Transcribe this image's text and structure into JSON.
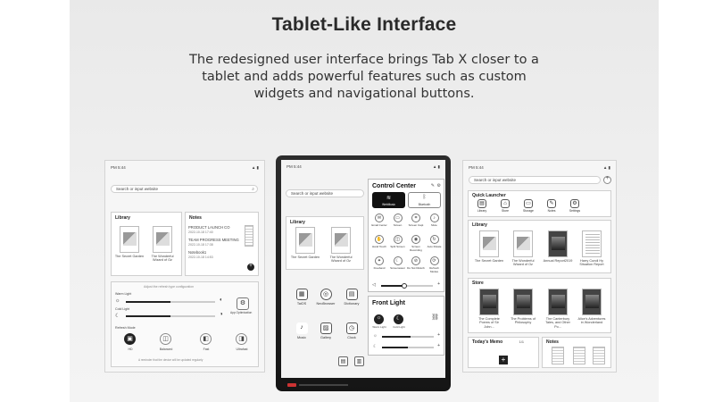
{
  "header": {
    "title": "Tablet-Like Interface",
    "description": "The redesigned user interface brings Tab X closer to a tablet and adds powerful features such as custom widgets and navigational buttons."
  },
  "colors": {
    "panel_bg": "#ececec",
    "device_body": "#1e1e1e",
    "accent_red": "#cc3333"
  },
  "left_screen": {
    "status_time": "PM 5:44",
    "search_placeholder": "Search or input website",
    "library": {
      "title": "Library",
      "books": [
        {
          "label": "The Secret Garden"
        },
        {
          "label": "The Wonderful Wizard of Oz"
        }
      ]
    },
    "notes": {
      "title": "Notes",
      "items": [
        {
          "title": "PRODUCT LAUNCH CO",
          "date": "2022-10-18 17:40"
        },
        {
          "title": "TEAM PROGRESS MEETING",
          "date": "2022-10-18 17:38"
        },
        {
          "title": "Notebook1",
          "date": "2022-10-18 14:53"
        }
      ]
    },
    "settings": {
      "hint": "Adjust the refresh type configuration",
      "warm_label": "Warm Light",
      "cold_label": "Cold Light",
      "refresh_label": "Refresh Mode",
      "app_opt": "App Optimization",
      "modes": [
        "HD",
        "Balanced",
        "Fast",
        "Ultrafast"
      ],
      "footer": "A reminder that the device will be updated regularly"
    }
  },
  "center_device": {
    "status_time": "PM 5:44",
    "search_placeholder": "Search or input website",
    "library_title": "Library",
    "books": [
      {
        "label": "The Secret Garden"
      },
      {
        "label": "The Wonderful Wizard of Oz"
      }
    ],
    "apps": [
      {
        "label": "TaiOS",
        "icon": "calendar-icon"
      },
      {
        "label": "NeoBrowser",
        "icon": "browser-icon"
      },
      {
        "label": "Dictionary",
        "icon": "book-icon"
      },
      {
        "label": "Music",
        "icon": "music-icon"
      },
      {
        "label": "Gallery",
        "icon": "image-icon"
      },
      {
        "label": "Clock",
        "icon": "clock-icon"
      }
    ],
    "control_center": {
      "title": "Control Center",
      "tiles": [
        {
          "label": "WebMusic",
          "icon": "wifi-icon",
          "active": true
        },
        {
          "label": "Bluetooth",
          "icon": "bluetooth-icon",
          "active": false
        }
      ],
      "toggles": [
        {
          "label": "Email Center",
          "icon": "mail-icon"
        },
        {
          "label": "Screen",
          "icon": "screen-icon"
        },
        {
          "label": "Screen Capt",
          "icon": "crop-icon"
        },
        {
          "label": "Mute",
          "icon": "mute-icon"
        },
        {
          "label": "Hand Touch",
          "icon": "hand-icon"
        },
        {
          "label": "Split Screen",
          "icon": "split-icon"
        },
        {
          "label": "Screen Recording",
          "icon": "record-icon"
        },
        {
          "label": "Auto Rotate",
          "icon": "rotate-icon"
        },
        {
          "label": "Freeband",
          "icon": "freeband-icon"
        },
        {
          "label": "Screensaver",
          "icon": "moon-icon"
        },
        {
          "label": "Do Not Disturb",
          "icon": "dnd-icon"
        },
        {
          "label": "Refresh Modes",
          "icon": "refresh-icon"
        }
      ],
      "volume_level": 0.45
    },
    "front_light": {
      "title": "Front Light",
      "buttons": [
        {
          "label": "Warm Light",
          "icon": "sun-icon"
        },
        {
          "label": "Cold Light",
          "icon": "moon-icon"
        }
      ],
      "warm_level": 0.55,
      "cold_level": 0.5
    }
  },
  "right_screen": {
    "status_time": "PM 5:44",
    "search_placeholder": "Search or input website",
    "quick_launcher": {
      "title": "Quick Launcher",
      "items": [
        {
          "label": "Library",
          "icon": "library-icon"
        },
        {
          "label": "Store",
          "icon": "store-icon"
        },
        {
          "label": "Storage",
          "icon": "folder-icon"
        },
        {
          "label": "Notes",
          "icon": "notes-icon"
        },
        {
          "label": "Settings",
          "icon": "gear-icon"
        }
      ]
    },
    "library": {
      "title": "Library",
      "books": [
        {
          "label": "The Secret Garden"
        },
        {
          "label": "The Wonderful Wizard of Oz"
        },
        {
          "label": "Annual Report2019"
        },
        {
          "label": "Harry Cundi Hy Situation Report"
        }
      ]
    },
    "store": {
      "title": "Store",
      "books": [
        {
          "label": "The Complete Poems of Sir John..."
        },
        {
          "label": "The Problems of Philosophy"
        },
        {
          "label": "The Canterbury Tales, and Other Po..."
        },
        {
          "label": "Alice's Adventures in Wonderland"
        }
      ]
    },
    "todays_memo": {
      "title": "Today's Memo",
      "page": "1/1"
    },
    "notes": {
      "title": "Notes"
    }
  }
}
